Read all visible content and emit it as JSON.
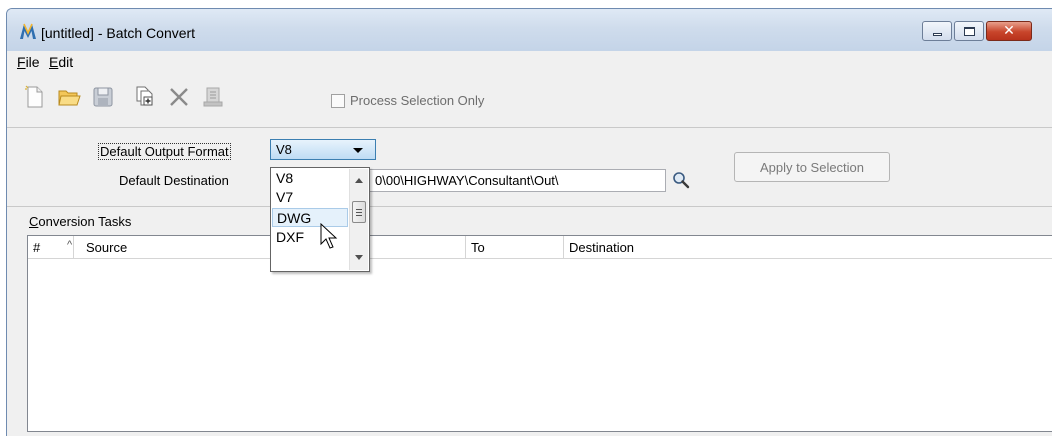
{
  "window": {
    "title": "[untitled] - Batch Convert",
    "close_glyph": "✕"
  },
  "menu": [
    {
      "mnemonic": "F",
      "rest": "ile"
    },
    {
      "mnemonic": "E",
      "rest": "dit"
    }
  ],
  "toolbar": {
    "icons": [
      "new-file-icon",
      "open-folder-icon",
      "save-icon",
      "add-files-icon",
      "delete-icon",
      "process-icon"
    ],
    "process_selection_label": "Process Selection Only",
    "process_selection_checked": false
  },
  "settings": {
    "default_output_format_label": "Default Output Format",
    "default_output_format_value": "V8",
    "default_destination_label": "Default Destination",
    "default_destination_value": "0\\00\\HIGHWAY\\Consultant\\Out\\",
    "apply_button": "Apply to Selection"
  },
  "format_dropdown": {
    "options": [
      "V8",
      "V7",
      "DWG",
      "DXF"
    ],
    "hovered": "DWG"
  },
  "tasks": {
    "label_mnemonic": "C",
    "label_rest": "onversion Tasks",
    "columns": [
      "#",
      "Source",
      "To",
      "Destination"
    ],
    "sort_indicator": "^",
    "rows": []
  },
  "colors": {
    "title_bar": "#cfdcec",
    "close_button": "#c8452b",
    "dropdown_hover": "#e5f1fb"
  }
}
